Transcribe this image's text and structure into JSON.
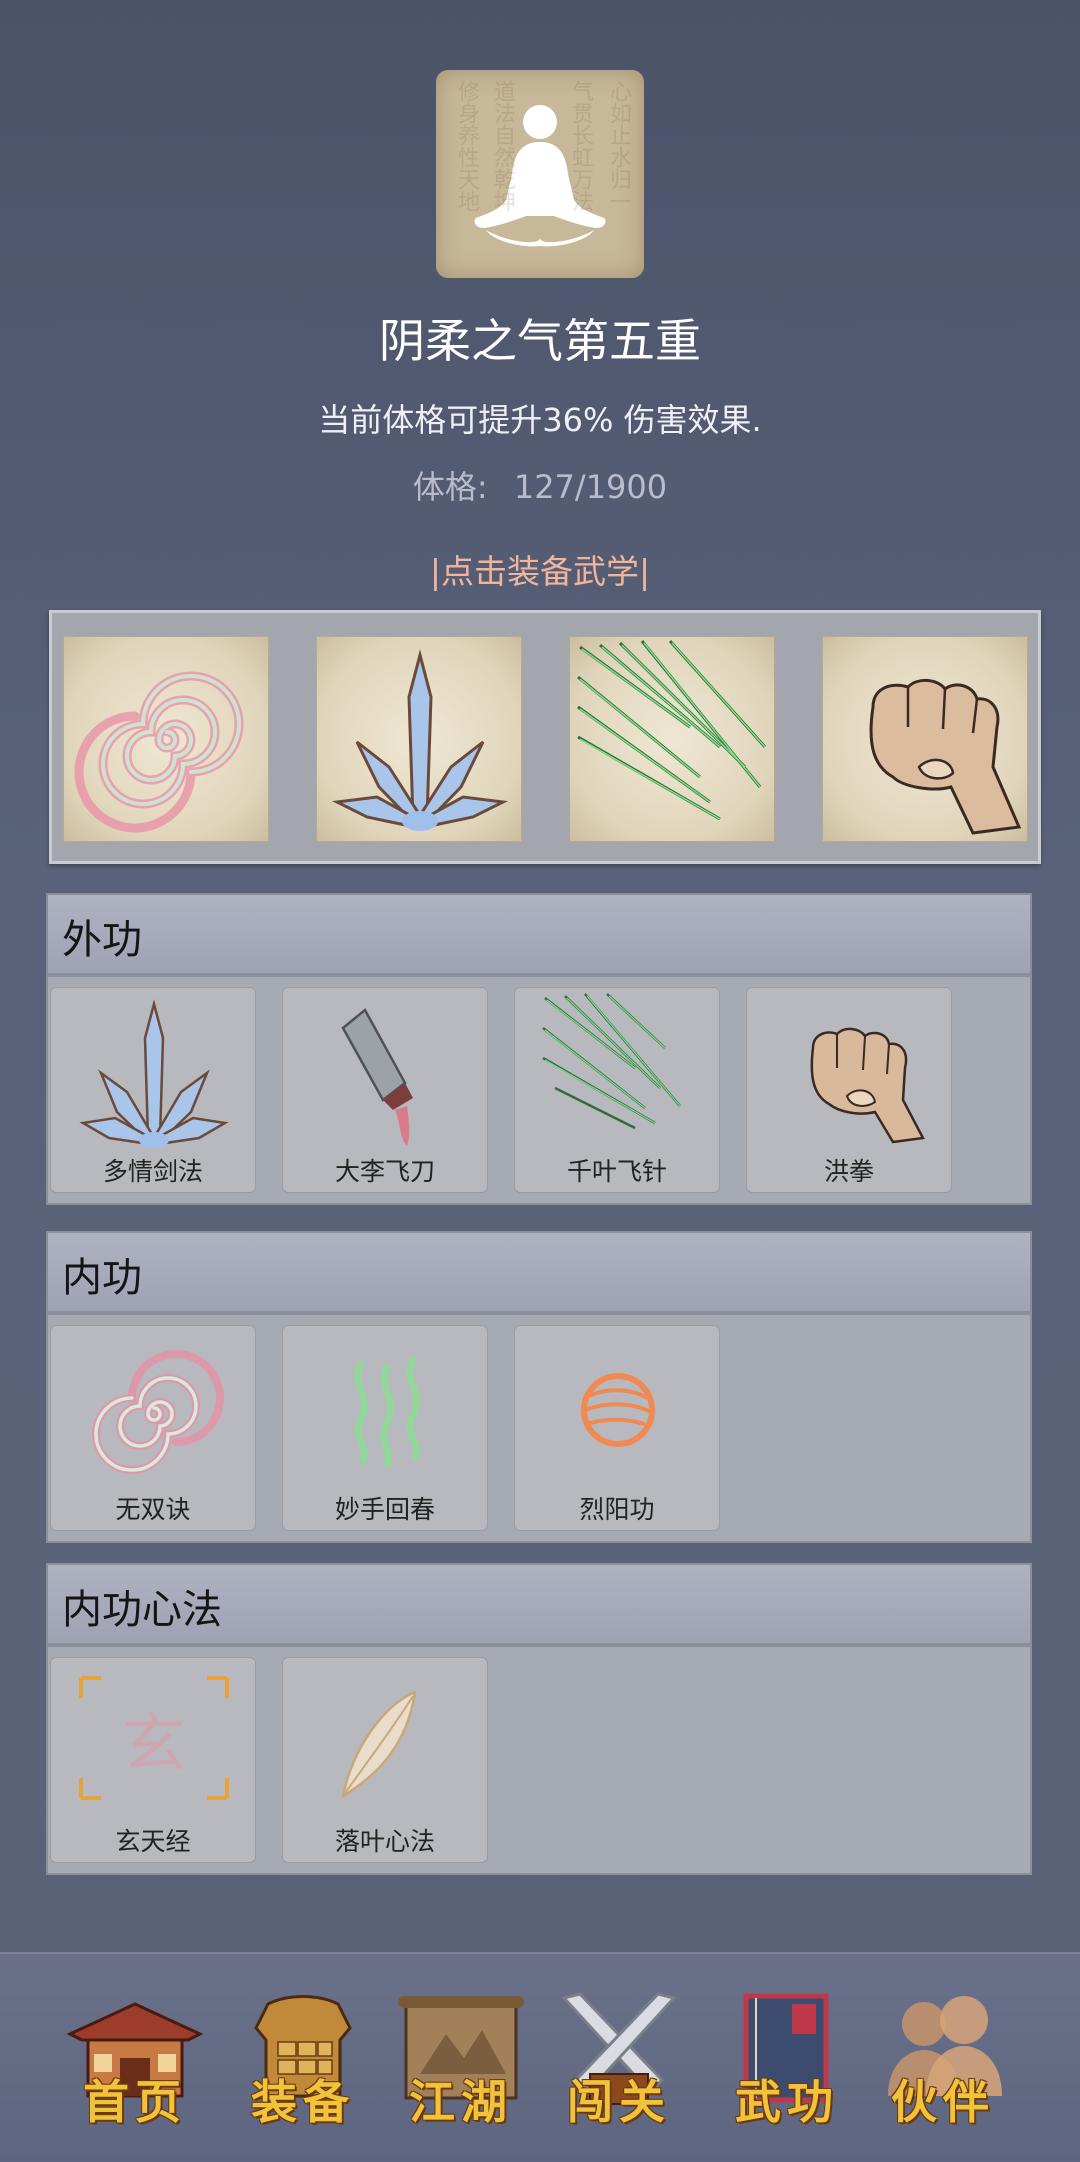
{
  "header": {
    "title": "阴柔之气第五重",
    "description": "当前体格可提升36% 伤害效果.",
    "stat_label": "体格:",
    "stat_value": "127/1900",
    "equip_prompt": "|点击装备武学|"
  },
  "equipped": [
    {
      "icon": "swirl-icon"
    },
    {
      "icon": "blade-fan-icon"
    },
    {
      "icon": "needles-icon"
    },
    {
      "icon": "fist-icon"
    }
  ],
  "sections": {
    "outer": {
      "title": "外功",
      "skills": [
        {
          "name": "多情剑法",
          "icon": "blade-fan-icon"
        },
        {
          "name": "大李飞刀",
          "icon": "cleaver-icon"
        },
        {
          "name": "千叶飞针",
          "icon": "needles-icon"
        },
        {
          "name": "洪拳",
          "icon": "fist-icon"
        }
      ]
    },
    "inner": {
      "title": "内功",
      "skills": [
        {
          "name": "无双诀",
          "icon": "swirl-icon"
        },
        {
          "name": "妙手回春",
          "icon": "healing-waves-icon"
        },
        {
          "name": "烈阳功",
          "icon": "sun-orb-icon"
        }
      ]
    },
    "mind": {
      "title": "内功心法",
      "skills": [
        {
          "name": "玄天经",
          "icon": "xuan-glyph-icon",
          "glyph": "玄"
        },
        {
          "name": "落叶心法",
          "icon": "leaf-icon"
        }
      ]
    }
  },
  "nav": [
    {
      "label": "首页",
      "icon": "temple-icon"
    },
    {
      "label": "装备",
      "icon": "armor-icon"
    },
    {
      "label": "江湖",
      "icon": "scroll-map-icon"
    },
    {
      "label": "闯关",
      "icon": "crossed-swords-icon"
    },
    {
      "label": "武功",
      "icon": "book-icon"
    },
    {
      "label": "伙伴",
      "icon": "companions-icon"
    }
  ],
  "colors": {
    "accent_link": "#f0b59a",
    "nav_label": "#f1c23a",
    "background": "#59627a"
  }
}
